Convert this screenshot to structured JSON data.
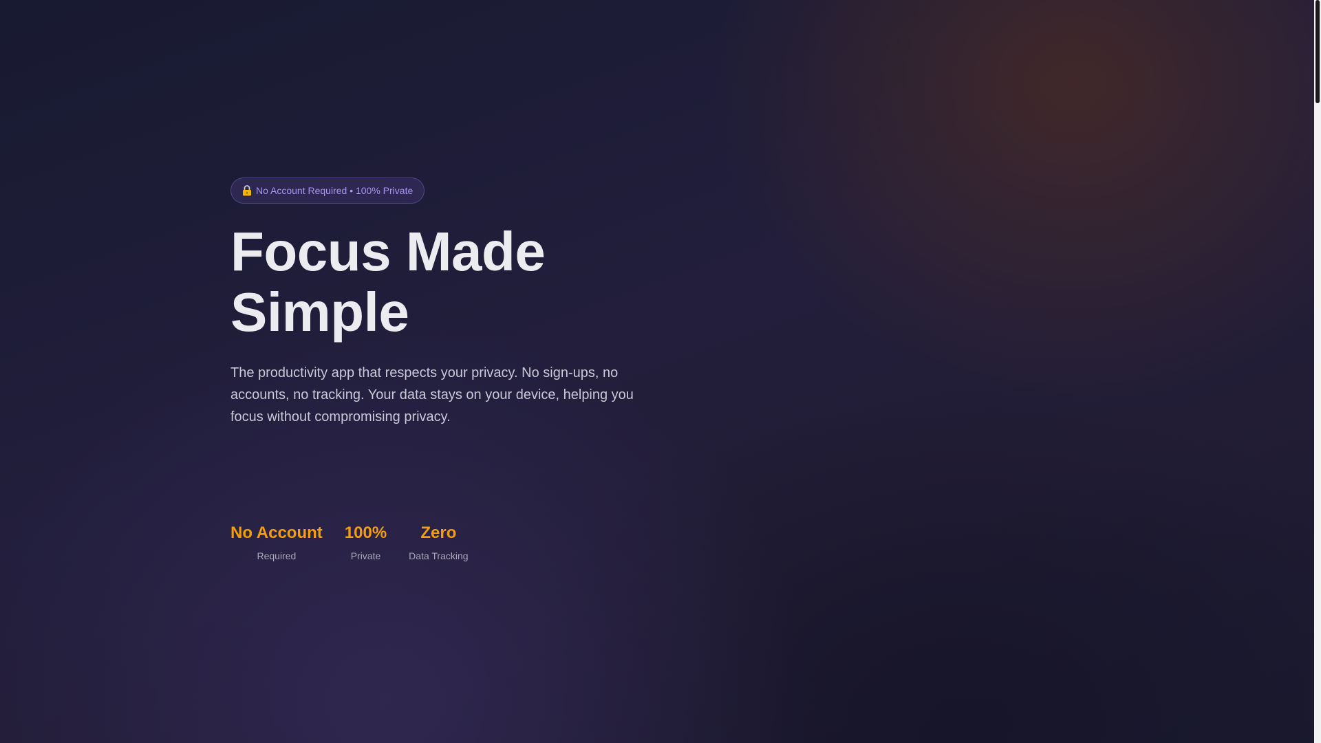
{
  "hero": {
    "badge": {
      "icon": "lock-icon",
      "text": "No Account Required • 100% Private"
    },
    "title_line1": "Focus Made",
    "title_line2": "Simple",
    "subtitle": "The productivity app that respects your privacy. No sign-ups, no accounts, no tracking. Your data stays on your device, helping you focus without compromising privacy."
  },
  "stats": [
    {
      "value": "No Account",
      "label": "Required"
    },
    {
      "value": "100%",
      "label": "Private"
    },
    {
      "value": "Zero",
      "label": "Data Tracking"
    }
  ],
  "colors": {
    "accent": "#f59e0b",
    "badge_text": "#a996f0",
    "background": "#1f1c38"
  }
}
